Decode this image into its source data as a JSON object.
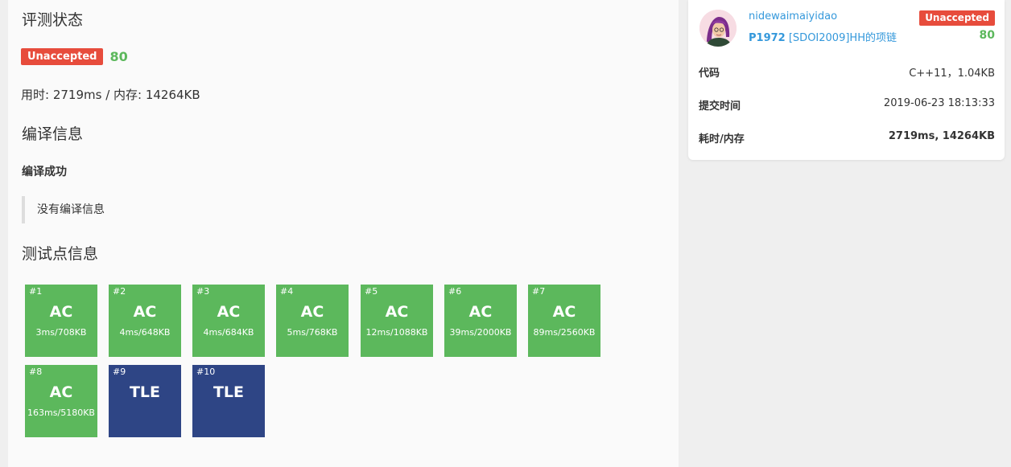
{
  "main": {
    "heading_status": "评测状态",
    "status_badge": "Unaccepted",
    "score": "80",
    "usage": "用时: 2719ms / 内存: 14264KB",
    "heading_compile": "编译信息",
    "compile_result": "编译成功",
    "compile_message": "没有编译信息",
    "heading_tests": "测试点信息",
    "testcases": [
      {
        "id": "#1",
        "status": "AC",
        "metric": "3ms/708KB"
      },
      {
        "id": "#2",
        "status": "AC",
        "metric": "4ms/648KB"
      },
      {
        "id": "#3",
        "status": "AC",
        "metric": "4ms/684KB"
      },
      {
        "id": "#4",
        "status": "AC",
        "metric": "5ms/768KB"
      },
      {
        "id": "#5",
        "status": "AC",
        "metric": "12ms/1088KB"
      },
      {
        "id": "#6",
        "status": "AC",
        "metric": "39ms/2000KB"
      },
      {
        "id": "#7",
        "status": "AC",
        "metric": "89ms/2560KB"
      },
      {
        "id": "#8",
        "status": "AC",
        "metric": "163ms/5180KB"
      },
      {
        "id": "#9",
        "status": "TLE",
        "metric": ""
      },
      {
        "id": "#10",
        "status": "TLE",
        "metric": ""
      }
    ]
  },
  "sidebar": {
    "username": "nidewaimaiyidao",
    "problem_id": "P1972",
    "problem_title": "[SDOI2009]HH的项链",
    "status_badge": "Unaccepted",
    "score": "80",
    "rows": [
      {
        "key": "代码",
        "value": "C++11，1.04KB"
      },
      {
        "key": "提交时间",
        "value": "2019-06-23 18:13:33"
      },
      {
        "key": "耗时/内存",
        "value": "2719ms, 14264KB"
      }
    ]
  },
  "colors": {
    "ac": "#5cb85c",
    "tle": "#2e4585",
    "unaccepted": "#e74c3c",
    "link": "#3498db"
  }
}
